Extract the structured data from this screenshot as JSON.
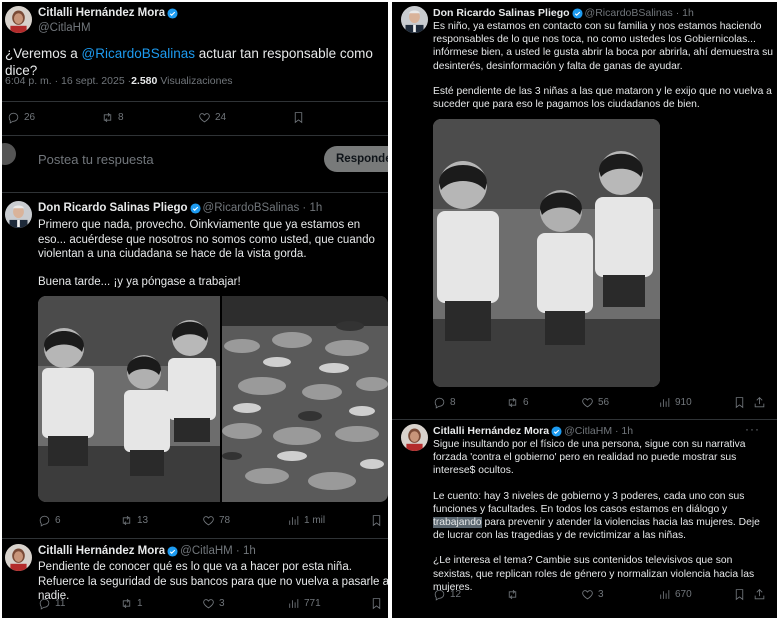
{
  "left": {
    "main_tweet": {
      "author_name": "Citlalli Hernández Mora",
      "author_handle": "@CitlaHM",
      "mention": "@RicardoBSalinas",
      "text_before": "¿Veremos a ",
      "text_after": " actuar tan responsable como dice?",
      "timestamp": "6:04 p. m. · 16 sept. 2025 · ",
      "views_count": "2.580",
      "views_label": "Visualizaciones",
      "replies": "26",
      "retweets": "8",
      "likes": "24"
    },
    "compose": {
      "placeholder": "Postea tu respuesta",
      "reply_button": "Responder"
    },
    "reply1": {
      "author_name": "Don Ricardo Salinas Pliego",
      "author_handle": "@RicardoBSalinas · 1h",
      "paragraph1": "Primero que nada, provecho. Oinkviamente que ya estamos en eso... acuérdese que nosotros no somos como usted, que cuando violentan a una ciudadana se hace de la vista gorda.",
      "paragraph2": "Buena tarde... ¡y ya póngase a trabajar!",
      "replies": "6",
      "retweets": "13",
      "likes": "78",
      "views": "1 mil"
    },
    "reply2": {
      "author_name": "Citlalli Hernández Mora",
      "author_handle": "@CitlaHM · 1h",
      "text": "Pendiente de conocer qué es lo que va a hacer por esta niña. Refuerce la seguridad de sus bancos para que no vuelva a pasarle a nadie.",
      "replies": "11",
      "retweets": "1",
      "likes": "3",
      "views": "771"
    }
  },
  "right": {
    "tweet1": {
      "author_name": "Don Ricardo Salinas Pliego",
      "author_handle": "@RicardoBSalinas · 1h",
      "paragraph1": "Es niño, ya estamos en contacto con su familia y nos estamos haciendo responsables de lo que nos toca, no como ustedes los Gobiernicolas... infórmese bien, a usted le gusta abrir la boca por abrirla, ahí demuestra su desinterés, desinformación y falta de ganas de ayudar.",
      "paragraph2": "Esté pendiente de las 3 niñas a las que mataron y le exijo que no vuelva a suceder que para eso le pagamos los ciudadanos de bien.",
      "replies": "8",
      "retweets": "6",
      "likes": "56",
      "views": "910"
    },
    "tweet2": {
      "author_name": "Citlalli Hernández Mora",
      "author_handle": "@CitlaHM · 1h",
      "paragraph1": "Sigue insultando por el físico de una persona, sigue con su narrativa forzada 'contra el gobierno' pero en realidad no puede mostrar sus interese$ ocultos.",
      "p2_before": "Le cuento: hay 3 niveles de gobierno y 3 poderes, cada uno con sus funciones y facultades. En todos los casos estamos en diálogo y ",
      "p2_highlight": "trabajando",
      "p2_after": " para prevenir y atender la violencias hacia las mujeres. Deje de lucrar con las tragedias y de revictimizar a las niñas.",
      "paragraph3": "¿Le interesa el tema? Cambie sus contenidos televisivos que son sexistas, que replican roles de género y normalizan violencia hacia las mujeres.",
      "replies": "12",
      "likes": "3",
      "views": "670"
    }
  },
  "colors": {
    "background": "#000000",
    "text": "#e7e9ea",
    "muted": "#71767b",
    "accent": "#1d9bf0",
    "divider": "#2f3336"
  }
}
